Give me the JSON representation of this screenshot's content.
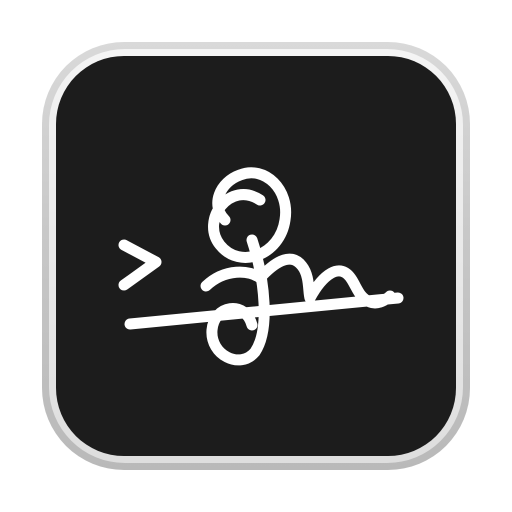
{
  "icon": {
    "name": "signature-app-icon",
    "glyph": "signature-icon",
    "colors": {
      "tile": "#1c1c1c",
      "bezel_outer": "#c8c8c8",
      "bezel_inner": "#ededed",
      "glyph": "#ffffff"
    }
  }
}
